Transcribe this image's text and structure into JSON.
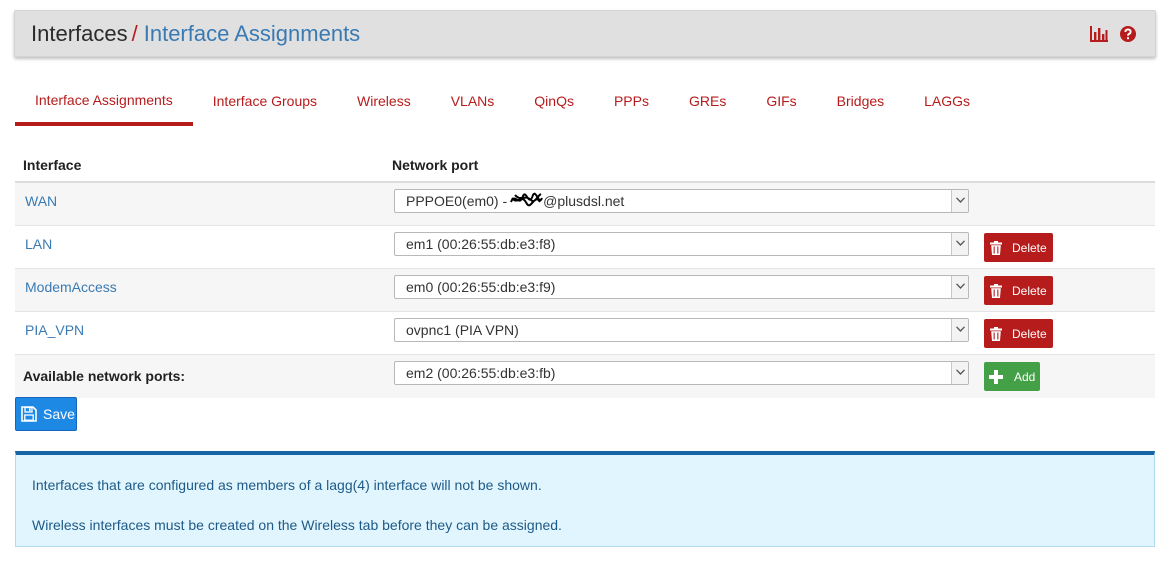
{
  "breadcrumb": {
    "parent": "Interfaces",
    "separator": "/",
    "current": "Interface Assignments"
  },
  "header_icons": [
    {
      "name": "chart-icon",
      "color": "#b71c1c"
    },
    {
      "name": "help-icon",
      "color": "#b71c1c"
    }
  ],
  "tabs": [
    {
      "label": "Interface Assignments",
      "active": true
    },
    {
      "label": "Interface Groups"
    },
    {
      "label": "Wireless"
    },
    {
      "label": "VLANs"
    },
    {
      "label": "QinQs"
    },
    {
      "label": "PPPs"
    },
    {
      "label": "GREs"
    },
    {
      "label": "GIFs"
    },
    {
      "label": "Bridges"
    },
    {
      "label": "LAGGs"
    }
  ],
  "table": {
    "headers": {
      "interface": "Interface",
      "network_port": "Network port"
    },
    "rows": [
      {
        "interface": "WAN",
        "port_prefix": "PPPOE0(em0) -",
        "port_suffix": "@plusdsl.net",
        "redacted": true
      },
      {
        "interface": "LAN",
        "port": "em1 (00:26:55:db:e3:f8)",
        "action": "Delete"
      },
      {
        "interface": "ModemAccess",
        "port": "em0 (00:26:55:db:e3:f9)",
        "action": "Delete"
      },
      {
        "interface": "PIA_VPN",
        "port": "ovpnc1 (PIA VPN)",
        "action": "Delete"
      }
    ],
    "available": {
      "label": "Available network ports:",
      "port": "em2 (00:26:55:db:e3:fb)",
      "action": "Add"
    }
  },
  "save_label": "Save",
  "info": {
    "line1": "Interfaces that are configured as members of a lagg(4) interface will not be shown.",
    "line2": "Wireless interfaces must be created on the Wireless tab before they can be assigned."
  },
  "colors": {
    "danger": "#b71c1c",
    "success": "#43a047",
    "primary": "#1e88e5",
    "link": "#3a7ab3",
    "info_bg": "#e1f5fe"
  }
}
